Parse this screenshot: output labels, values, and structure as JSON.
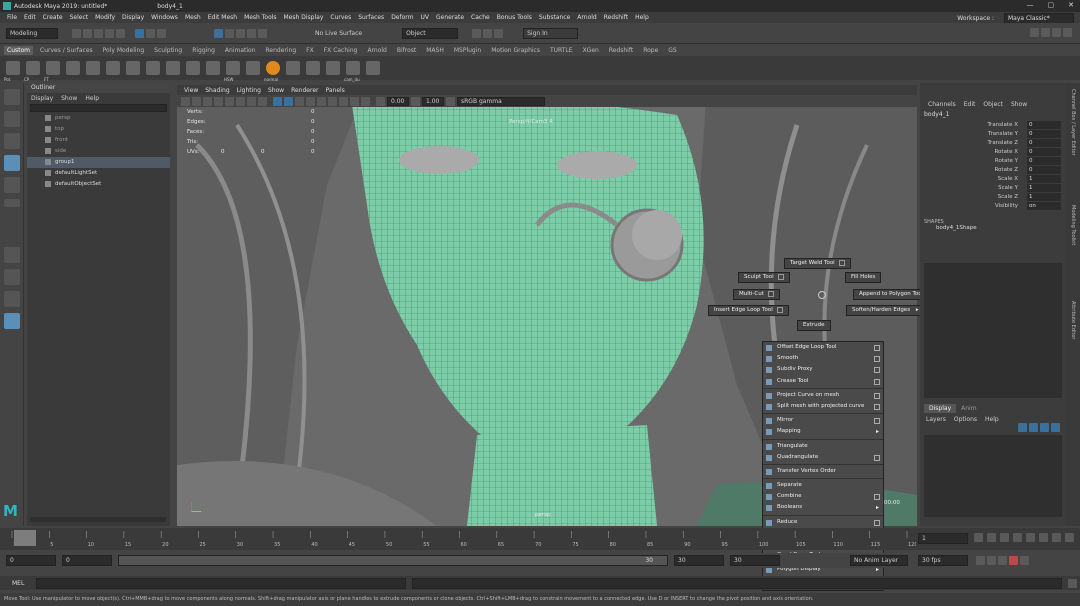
{
  "title": {
    "app": "Autodesk Maya 2019: untitled*",
    "tab": "body4_1"
  },
  "menus": [
    "File",
    "Edit",
    "Create",
    "Select",
    "Modify",
    "Display",
    "Windows",
    "Mesh",
    "Edit Mesh",
    "Mesh Tools",
    "Mesh Display",
    "Curves",
    "Surfaces",
    "Deform",
    "UV",
    "Generate",
    "Cache",
    "Bonus Tools",
    "Substance",
    "Arnold",
    "Redshift",
    "Help"
  ],
  "workspace": {
    "label": "Workspace :",
    "value": "Maya Classic*"
  },
  "status": {
    "mode": "Modeling",
    "live": "No Live Surface",
    "object": "Object",
    "signin": "Sign In"
  },
  "shelf_tabs": [
    "Custom",
    "Curves / Surfaces",
    "Poly Modeling",
    "Sculpting",
    "Rigging",
    "Animation",
    "Rendering",
    "FX",
    "FX Caching",
    "Arnold",
    "Bifrost",
    "MASH",
    "MSPlugin",
    "Motion Graphics",
    "TURTLE",
    "XGen",
    "Redshift",
    "Rope",
    "GS"
  ],
  "shelf_icons": [
    "Pot",
    "CP",
    "FT",
    "",
    "",
    "",
    "",
    "",
    "",
    "",
    "",
    "HSW",
    "",
    "normal",
    "",
    "",
    "",
    "cam_du",
    ""
  ],
  "outliner": {
    "title": "Outliner",
    "menu": [
      "Display",
      "Show",
      "Help"
    ],
    "items": [
      "persp",
      "top",
      "front",
      "side",
      "group1",
      "defaultLightSet",
      "defaultObjectSet"
    ]
  },
  "viewport": {
    "menu": [
      "View",
      "Shading",
      "Lighting",
      "Show",
      "Renderer",
      "Panels"
    ],
    "exposure": "0.00",
    "gamma": "1.00",
    "colorspace": "sRGB gamma",
    "camera_label": "Persp/4/Cam3 R",
    "frame_label": "persp",
    "frame_value": "00:00",
    "hud": [
      {
        "label": "Verts:",
        "a": "",
        "b": "",
        "c": "0"
      },
      {
        "label": "Edges:",
        "a": "",
        "b": "",
        "c": "0"
      },
      {
        "label": "Faces:",
        "a": "",
        "b": "",
        "c": "0"
      },
      {
        "label": "Tris:",
        "a": "",
        "b": "",
        "c": "0"
      },
      {
        "label": "UVs:",
        "a": "0",
        "b": "0",
        "c": "0"
      }
    ]
  },
  "marking_menu": {
    "target_weld": "Target Weld Tool",
    "sculpt": "Sculpt Tool",
    "fill_holes": "Fill Holes",
    "multi_cut": "Multi-Cut",
    "append_polygon": "Append to Polygon Tool",
    "insert_edge_loop": "Insert Edge Loop Tool",
    "soften_harden": "Soften/Harden Edges",
    "extrude": "Extrude"
  },
  "context_menu": {
    "groups": [
      [
        {
          "label": "Offset Edge Loop Tool",
          "cb": true
        },
        {
          "label": "Smooth",
          "cb": true
        },
        {
          "label": "Subdiv Proxy",
          "cb": true
        },
        {
          "label": "Crease Tool",
          "cb": true
        }
      ],
      [
        {
          "label": "Project Curve on mesh",
          "cb": true
        },
        {
          "label": "Split mesh with projected curve",
          "cb": true
        }
      ],
      [
        {
          "label": "Mirror",
          "cb": true
        },
        {
          "label": "Mapping",
          "arrow": true
        }
      ],
      [
        {
          "label": "Triangulate",
          "cb": false
        },
        {
          "label": "Quadrangulate",
          "cb": true
        }
      ],
      [
        {
          "label": "Transfer Vertex Order",
          "cb": false
        }
      ],
      [
        {
          "label": "Separate",
          "cb": false
        },
        {
          "label": "Combine",
          "cb": true
        },
        {
          "label": "Booleans",
          "arrow": true
        }
      ],
      [
        {
          "label": "Reduce",
          "cb": true
        },
        {
          "label": "Cleanup...",
          "cb": false
        },
        {
          "label": "Connect Tool",
          "cb": true
        },
        {
          "label": "Quad Draw Tool",
          "cb": true
        }
      ],
      [
        {
          "label": "Polygon Display",
          "arrow": true
        }
      ],
      [
        {
          "label": "BonusTools",
          "arrow": true
        }
      ]
    ]
  },
  "channel_box": {
    "menu": [
      "Channels",
      "Edit",
      "Object",
      "Show"
    ],
    "object": "body4_1",
    "channels": [
      {
        "label": "Translate X",
        "value": "0"
      },
      {
        "label": "Translate Y",
        "value": "0"
      },
      {
        "label": "Translate Z",
        "value": "0"
      },
      {
        "label": "Rotate X",
        "value": "0"
      },
      {
        "label": "Rotate Y",
        "value": "0"
      },
      {
        "label": "Rotate Z",
        "value": "0"
      },
      {
        "label": "Scale X",
        "value": "1"
      },
      {
        "label": "Scale Y",
        "value": "1"
      },
      {
        "label": "Scale Z",
        "value": "1"
      },
      {
        "label": "Visibility",
        "value": "on"
      }
    ],
    "shapes_title": "SHAPES",
    "shape": "body4_1Shape"
  },
  "layer_editor": {
    "tabs": [
      "Display",
      "Anim"
    ],
    "menu": [
      "Layers",
      "Options",
      "Help"
    ]
  },
  "side_tabs": [
    "Channel Box / Layer Editor",
    "Modeling Toolkit",
    "Attribute Editor"
  ],
  "timeslider": {
    "ticks": [
      "1",
      "5",
      "10",
      "15",
      "20",
      "25",
      "30",
      "35",
      "40",
      "45",
      "50",
      "55",
      "60",
      "65",
      "70",
      "75",
      "80",
      "85",
      "90",
      "95",
      "100",
      "105",
      "110",
      "115",
      "120"
    ],
    "current": "1"
  },
  "range": {
    "start": "0",
    "start2": "0",
    "end": "30",
    "end2": "30",
    "mid": "30",
    "anim_layer": "No Anim Layer",
    "fps": "30 fps"
  },
  "cmdline": {
    "label": "MEL"
  },
  "helpline": "Move Tool: Use manipulator to move object(s). Ctrl+MMB+drag to move components along normals. Shift+drag manipulator axis or plane handles to extrude components or clone objects. Ctrl+Shift+LMB+drag to constrain movement to a connected edge. Use D or INSERT to change the pivot position and axis orientation."
}
